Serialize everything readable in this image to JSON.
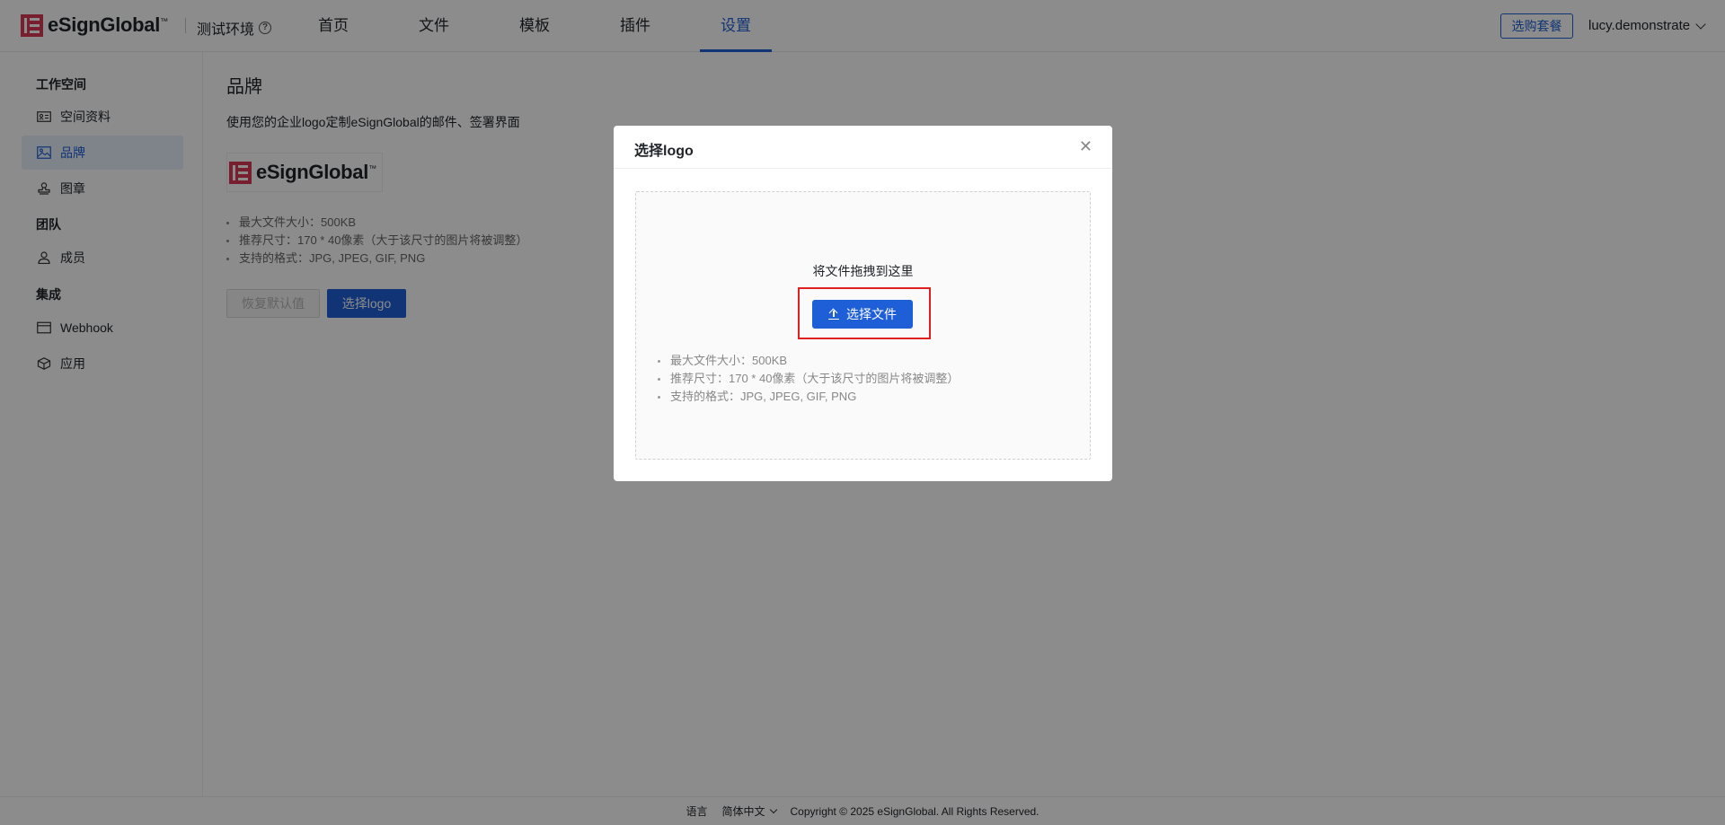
{
  "header": {
    "brand": "eSignGlobal",
    "brand_tm": "™",
    "env_label": "测试环境",
    "nav": [
      {
        "label": "首页",
        "active": false
      },
      {
        "label": "文件",
        "active": false
      },
      {
        "label": "模板",
        "active": false
      },
      {
        "label": "插件",
        "active": false
      },
      {
        "label": "设置",
        "active": true
      }
    ],
    "plan_button": "选购套餐",
    "username": "lucy.demonstrate"
  },
  "sidebar": {
    "groups": [
      {
        "title": "工作空间",
        "items": [
          {
            "label": "空间资料",
            "icon": "id-card-icon"
          },
          {
            "label": "品牌",
            "icon": "image-icon",
            "active": true
          },
          {
            "label": "图章",
            "icon": "stamp-icon"
          }
        ]
      },
      {
        "title": "团队",
        "items": [
          {
            "label": "成员",
            "icon": "user-icon"
          }
        ]
      },
      {
        "title": "集成",
        "items": [
          {
            "label": "Webhook",
            "icon": "webhook-icon"
          },
          {
            "label": "应用",
            "icon": "cube-icon"
          }
        ]
      }
    ]
  },
  "main": {
    "title": "品牌",
    "description": "使用您的企业logo定制eSignGlobal的邮件、签署界面",
    "hints": [
      "最大文件大小：500KB",
      "推荐尺寸：170 * 40像素（大于该尺寸的图片将被调整）",
      "支持的格式：JPG, JPEG, GIF, PNG"
    ],
    "reset_button": "恢复默认值",
    "choose_button": "选择logo"
  },
  "modal": {
    "title": "选择logo",
    "drop_text": "将文件拖拽到这里",
    "file_button": "选择文件",
    "hints": [
      "最大文件大小：500KB",
      "推荐尺寸：170 * 40像素（大于该尺寸的图片将被调整）",
      "支持的格式：JPG, JPEG, GIF, PNG"
    ]
  },
  "footer": {
    "language_label": "语言",
    "language_value": "简体中文",
    "copyright": "Copyright © 2025 eSignGlobal. All Rights Reserved."
  },
  "colors": {
    "accent": "#1e5fd8",
    "brand_red": "#d93a57",
    "highlight": "#e02020"
  }
}
